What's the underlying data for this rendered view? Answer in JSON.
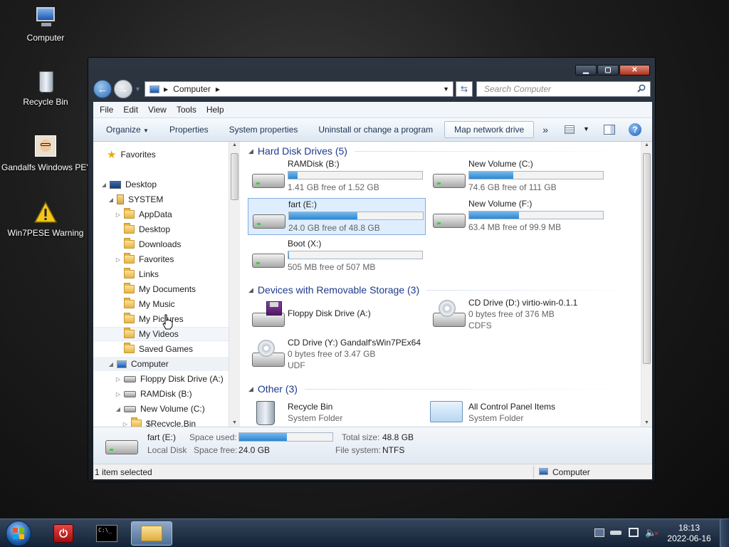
{
  "desktop": {
    "icons": [
      {
        "label": "Computer"
      },
      {
        "label": "Recycle Bin"
      },
      {
        "label": "Gandalfs Windows PE's"
      },
      {
        "label": "Win7PESE Warning"
      }
    ]
  },
  "window": {
    "caption_buttons": {
      "minimize": "▁",
      "maximize": "▢",
      "close": "✕"
    },
    "address": {
      "path": "Computer"
    },
    "search": {
      "placeholder": "Search Computer"
    },
    "menu": [
      "File",
      "Edit",
      "View",
      "Tools",
      "Help"
    ],
    "toolbar": {
      "organize": "Organize",
      "properties": "Properties",
      "system_properties": "System properties",
      "uninstall": "Uninstall or change a program",
      "map_drive": "Map network drive",
      "more": "»"
    },
    "nav": {
      "favorites": "Favorites",
      "tree": [
        "Desktop",
        "SYSTEM",
        "AppData",
        "Desktop",
        "Downloads",
        "Favorites",
        "Links",
        "My Documents",
        "My Music",
        "My Pictures",
        "My Videos",
        "Saved Games",
        "Computer",
        "Floppy Disk Drive (A:)",
        "RAMDisk (B:)",
        "New Volume (C:)",
        "$Recycle.Bin"
      ]
    },
    "content": {
      "groups": {
        "hdd": "Hard Disk Drives (5)",
        "removable": "Devices with Removable Storage (3)",
        "other": "Other (3)"
      },
      "drives": [
        {
          "name": "RAMDisk (B:)",
          "free": "1.41 GB free of 1.52 GB",
          "used_fraction": 0.07
        },
        {
          "name": "New Volume (C:)",
          "free": "74.6 GB free of 111 GB",
          "used_fraction": 0.33
        },
        {
          "name": "fart (E:)",
          "free": "24.0 GB free of 48.8 GB",
          "used_fraction": 0.51
        },
        {
          "name": "New Volume (F:)",
          "free": "63.4 MB free of 99.9 MB",
          "used_fraction": 0.37
        },
        {
          "name": "Boot (X:)",
          "free": "505 MB free of 507 MB",
          "used_fraction": 0.004
        }
      ],
      "removable": [
        {
          "name": "Floppy Disk Drive (A:)"
        },
        {
          "name": "CD Drive (D:) virtio-win-0.1.1",
          "free": "0 bytes free of 376 MB",
          "fs": "CDFS"
        },
        {
          "name": "CD Drive (Y:) Gandalf'sWin7PEx64",
          "free": "0 bytes free of 3.47 GB",
          "fs": "UDF"
        }
      ],
      "other": [
        {
          "name": "Recycle Bin",
          "sub": "System Folder"
        },
        {
          "name": "All Control Panel Items",
          "sub": "System Folder"
        }
      ]
    },
    "details": {
      "name": "fart (E:)",
      "type": "Local Disk",
      "space_used_label": "Space used:",
      "space_free_label": "Space free:",
      "space_free": "24.0 GB",
      "total_size_label": "Total size:",
      "total_size": "48.8 GB",
      "fs_label": "File system:",
      "fs": "NTFS",
      "used_fraction": 0.51
    },
    "status": {
      "selected": "1 item selected",
      "location": "Computer"
    }
  },
  "taskbar": {
    "clock_time": "18:13",
    "clock_date": "2022-06-16"
  },
  "colors": {
    "accent": "#2a87d4",
    "group_header": "#1e3a8c",
    "selection": "#deeeff"
  }
}
